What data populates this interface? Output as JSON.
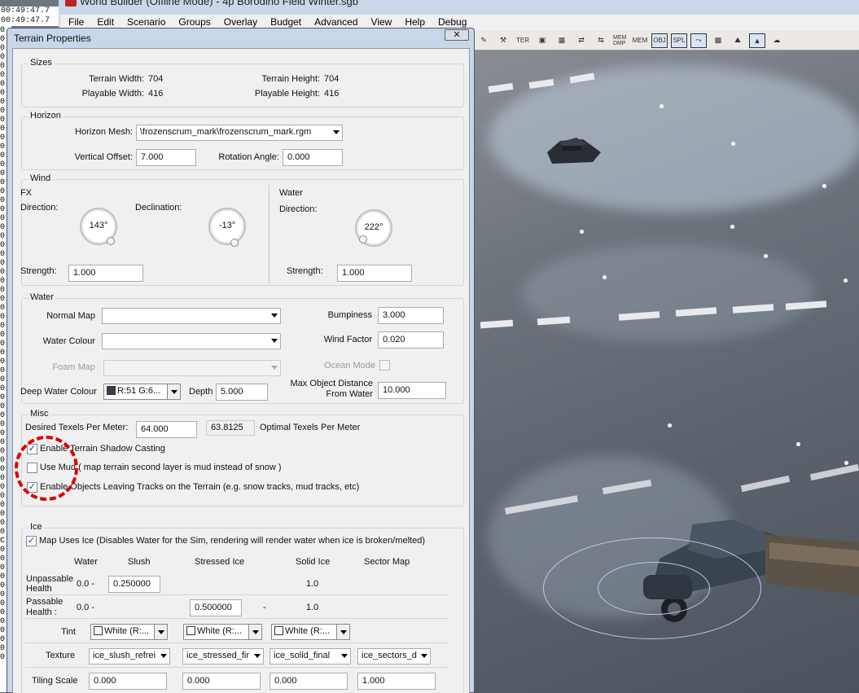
{
  "main_window": {
    "title": "World Builder (Offline Mode) - 4p Borodino Field Winter.sgb",
    "menu": [
      "File",
      "Edit",
      "Scenario",
      "Groups",
      "Overlay",
      "Budget",
      "Advanced",
      "View",
      "Help",
      "Debug"
    ]
  },
  "log": {
    "top_lines": [
      "00:49:47.7",
      "00:49:47.7"
    ],
    "side_chars": [
      "0",
      "0",
      "0",
      "0",
      "0",
      "0",
      "0",
      "0",
      "0",
      "0",
      "0",
      "0",
      "0",
      "0",
      "0",
      "0",
      "0",
      "0",
      "0",
      "0",
      "0",
      "0",
      "0",
      "0",
      "0",
      "0",
      "0",
      "0",
      "0",
      "0",
      "0",
      "0",
      "0",
      "0",
      "0",
      "0",
      "0",
      "0",
      "0",
      "0",
      "0",
      "0",
      "0",
      "0",
      "0",
      "0",
      "0",
      "0",
      "0",
      "0",
      "0",
      "0",
      "0",
      "0",
      "0",
      "0",
      "0",
      "0",
      "0",
      "Cl",
      "0",
      "0",
      "0",
      "0",
      "0",
      "0",
      "0",
      "0",
      "0",
      "0",
      "0",
      "0",
      "0"
    ]
  },
  "toolbar": {
    "buttons": [
      {
        "icon": "paint-icon",
        "text": ""
      },
      {
        "icon": "wand-icon",
        "text": ""
      },
      {
        "icon": "ter-icon",
        "text": "TER"
      },
      {
        "icon": "box-icon",
        "text": ""
      },
      {
        "icon": "grid-icon",
        "text": ""
      },
      {
        "icon": "arrows-icon",
        "text": ""
      },
      {
        "icon": "swap-icon",
        "text": ""
      },
      {
        "icon": "mem-dmp-icon",
        "text": "MEM DMP"
      },
      {
        "icon": "mem-stat-icon",
        "text": "MEM"
      },
      {
        "icon": "obj-icon",
        "text": "OBJ",
        "active": true
      },
      {
        "icon": "spl-icon",
        "text": "SPL",
        "active": true
      },
      {
        "icon": "path-icon",
        "text": "",
        "active": true
      },
      {
        "icon": "checker-icon",
        "text": ""
      },
      {
        "icon": "landscape-icon",
        "text": ""
      },
      {
        "icon": "mountain-icon",
        "text": "",
        "active": true
      },
      {
        "icon": "sky-icon",
        "text": ""
      }
    ]
  },
  "dialog": {
    "title": "Terrain Properties",
    "close": "✕",
    "sizes": {
      "title": "Sizes",
      "terrain_width_label": "Terrain Width:",
      "terrain_width": "704",
      "terrain_height_label": "Terrain Height:",
      "terrain_height": "704",
      "playable_width_label": "Playable Width:",
      "playable_width": "416",
      "playable_height_label": "Playable Height:",
      "playable_height": "416"
    },
    "horizon": {
      "title": "Horizon",
      "mesh_label": "Horizon Mesh:",
      "mesh_value": "\\frozenscrum_mark\\frozenscrum_mark.rgm",
      "offset_label": "Vertical Offset:",
      "offset_value": "7.000",
      "rotation_label": "Rotation Angle:",
      "rotation_value": "0.000"
    },
    "wind": {
      "title": "Wind",
      "fx_label": "FX",
      "direction_label": "Direction:",
      "direction_value": "143°",
      "declination_label": "Declination:",
      "declination_value": "-13°",
      "strength_label": "Strength:",
      "strength_value": "1.000",
      "water_label": "Water",
      "water_direction_label": "Direction:",
      "water_direction_value": "222°",
      "water_strength_label": "Strength:",
      "water_strength_value": "1.000"
    },
    "water": {
      "title": "Water",
      "normal_map_label": "Normal Map",
      "normal_map_value": "",
      "bumpiness_label": "Bumpiness",
      "bumpiness_value": "3.000",
      "water_colour_label": "Water Colour",
      "water_colour_value": "",
      "wind_factor_label": "Wind Factor",
      "wind_factor_value": "0.020",
      "foam_map_label": "Foam Map",
      "foam_map_value": "",
      "ocean_mode_label": "Ocean Mode",
      "deep_colour_label": "Deep Water Colour",
      "deep_colour_value": "R:51 G:6...",
      "deep_colour_swatch": "#33404c",
      "depth_label": "Depth",
      "depth_value": "5.000",
      "max_dist_label_1": "Max Object Distance",
      "max_dist_label_2": "From Water",
      "max_dist_value": "10.000"
    },
    "misc": {
      "title": "Misc",
      "texels_label": "Desired Texels Per Meter:",
      "texels_value": "64.000",
      "optimal_value": "63.8125",
      "optimal_label": "Optimal Texels Per Meter",
      "shadow_label": "Enable Terrain Shadow Casting",
      "shadow_checked": "✓",
      "mud_label": "Use Mud ( map terrain second layer is mud instead of snow )",
      "mud_checked": "",
      "tracks_label": "Enable Objects Leaving Tracks on the Terrain (e.g. snow tracks, mud tracks, etc)",
      "tracks_checked": "✓",
      "highlight_color": "#e00000"
    },
    "ice": {
      "title": "Ice",
      "uses_ice_label": "Map Uses Ice (Disables Water for the Sim, rendering will render water when ice is broken/melted)",
      "uses_ice_checked": "✓",
      "col_water": "Water",
      "col_slush": "Slush",
      "col_stressed": "Stressed Ice",
      "col_solid": "Solid Ice",
      "col_sector": "Sector Map",
      "unpassable_label_1": "Unpassable",
      "unpassable_label_2": "Health",
      "unpassable_range": "0.0 -",
      "unpassable_slush": "0.250000",
      "unpassable_solid": "1.0",
      "passable_label_1": "Passable",
      "passable_label_2": "Health :",
      "passable_range": "0.0 -",
      "passable_stressed": "0.500000",
      "passable_dash": "-",
      "passable_solid": "1.0",
      "tint_label": "Tint",
      "tint_slush": "White (R:...",
      "tint_stressed": "White (R:...",
      "tint_solid": "White (R:...",
      "texture_label": "Texture",
      "texture_slush": "ice_slush_refrei",
      "texture_stressed": "ice_stressed_fir",
      "texture_solid": "ice_solid_final",
      "texture_sector": "ice_sectors_d",
      "tiling_label": "Tiling Scale",
      "tiling_slush": "0.000",
      "tiling_stressed": "0.000",
      "tiling_solid": "0.000",
      "tiling_sector": "1.000"
    }
  }
}
